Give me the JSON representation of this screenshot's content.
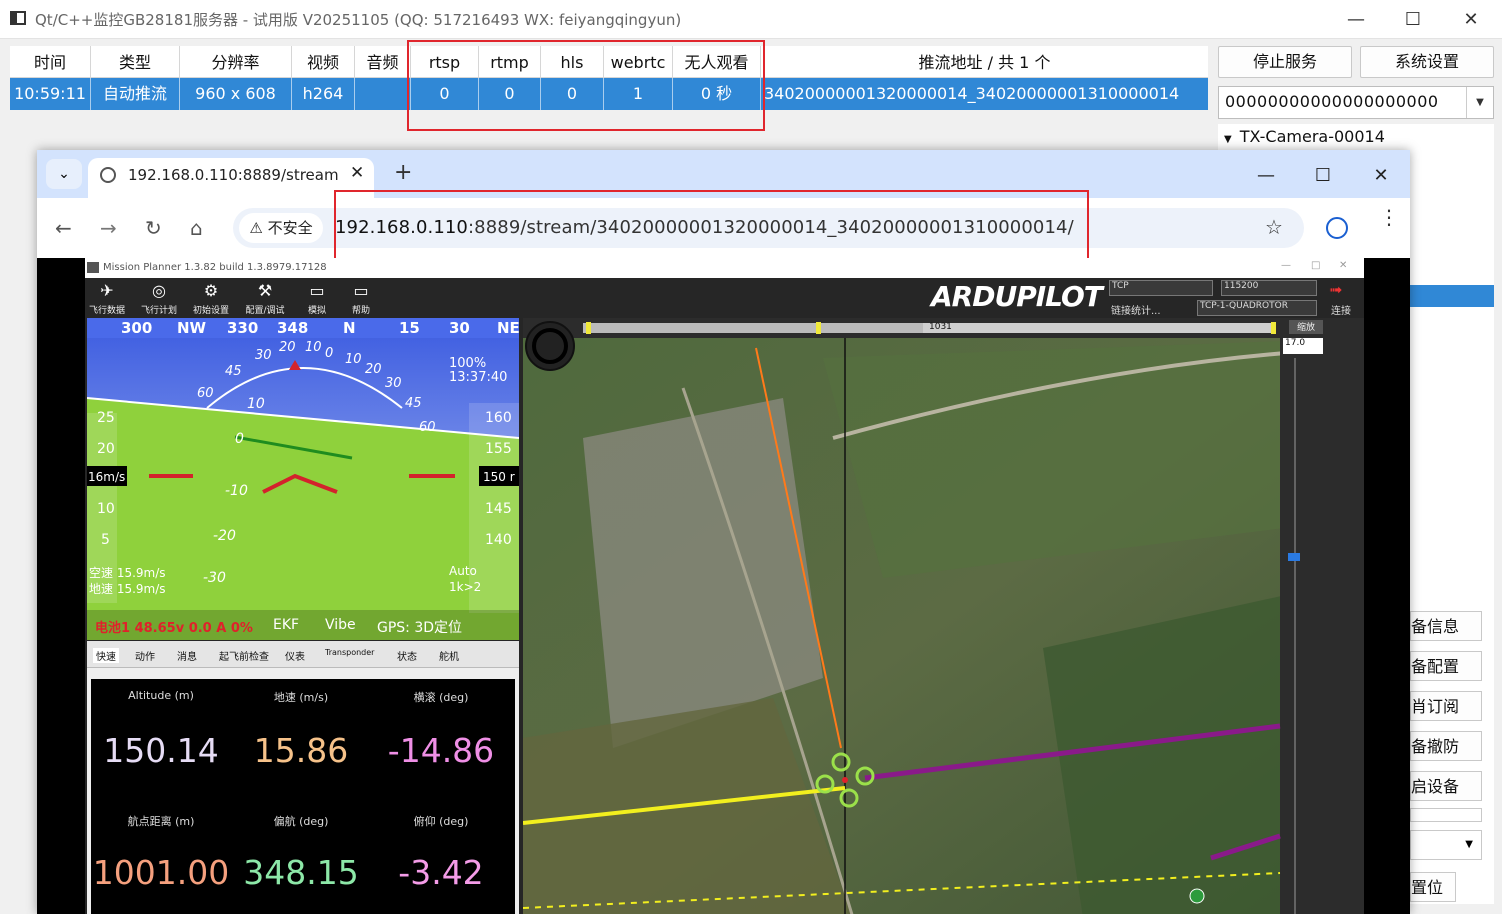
{
  "window": {
    "title": "Qt/C++监控GB28181服务器 - 试用版 V20251105 (QQ: 517216493 WX: feiyangqingyun)",
    "min_icon": "minimize-icon",
    "max_icon": "maximize-icon",
    "close_icon": "close-icon"
  },
  "stream_table": {
    "headers": [
      "时间",
      "类型",
      "分辨率",
      "视频",
      "音频",
      "rtsp",
      "rtmp",
      "hls",
      "webrtc",
      "无人观看",
      "推流地址 / 共 1 个"
    ],
    "row": [
      "10:59:11",
      "自动推流",
      "960 x 608",
      "h264",
      "",
      "0",
      "0",
      "0",
      "1",
      "0 秒",
      "34020000001320000014_34020000001310000014"
    ]
  },
  "side_panel": {
    "stop_service": "停止服务",
    "system_settings": "系统设置",
    "device_combo_value": "00000000000000000000",
    "tree_item": "TX-Camera-00014",
    "buttons": [
      "备信息",
      "备配置",
      "肖订阅",
      "备撤防",
      "启设备"
    ],
    "reset_button": "置位"
  },
  "browser": {
    "tab_title": "192.168.0.110:8889/stream/3",
    "security_label": "不安全",
    "url_host": "192.168.0.110",
    "url_rest": ":8889/stream/34020000001320000014_34020000001310000014/",
    "new_tab": "+"
  },
  "mission_planner": {
    "title": "Mission Planner 1.3.82 build 1.3.8979.17128",
    "menu": [
      "飞行数据",
      "飞行计划",
      "初始设置",
      "配置/调试",
      "模拟",
      "帮助"
    ],
    "logo": "ARDUPILOT",
    "port": "TCP",
    "baud": "115200",
    "link_stats": "链接统计...",
    "frame": "TCP-1-QUADROTOR",
    "connect": "连接",
    "hud": {
      "heading_scale": [
        "300",
        "NW",
        "330",
        "348",
        "N",
        "15",
        "30",
        "NE"
      ],
      "battery_pct": "100%",
      "time": "13:37:40",
      "speed_box": "16m/s",
      "alt_box": "150 r",
      "speed_ticks": [
        "25",
        "20",
        "10",
        "5"
      ],
      "alt_ticks": [
        "160",
        "155",
        "145",
        "140"
      ],
      "pitch_ticks": [
        "10",
        "0",
        "-10",
        "-20",
        "-30"
      ],
      "roll_ticks": [
        "60",
        "45",
        "30",
        "20",
        "10",
        "0",
        "10",
        "20",
        "30",
        "45",
        "60"
      ],
      "airspeed": "空速 15.9m/s",
      "groundspeed": "地速 15.9m/s",
      "mode": "Auto",
      "wp": "1k>2",
      "battery_line": "电池1 48.65v 0.0 A 0%",
      "ekf": "EKF",
      "vibe": "Vibe",
      "gps": "GPS: 3D定位"
    },
    "data_tabs": [
      "快速",
      "动作",
      "消息",
      "起飞前检查",
      "仪表",
      "Transponder",
      "状态",
      "舵机"
    ],
    "quick": [
      {
        "label": "Altitude (m)",
        "value": "150.14",
        "color": "#e6dcf5"
      },
      {
        "label": "地速 (m/s)",
        "value": "15.86",
        "color": "#f6c28a"
      },
      {
        "label": "横滚 (deg)",
        "value": "-14.86",
        "color": "#ef8fe6"
      },
      {
        "label": "航点距离 (m)",
        "value": "1001.00",
        "color": "#f5a07e"
      },
      {
        "label": "偏航 (deg)",
        "value": "348.15",
        "color": "#8de8a8"
      },
      {
        "label": "俯仰 (deg)",
        "value": "-3.42",
        "color": "#f49ce8"
      }
    ],
    "map": {
      "scale_value": "1031",
      "zoom_label": "缩放",
      "zoom_value": "17.0"
    }
  },
  "colors": {
    "selection": "#3088d6",
    "highlight_box": "#e0262d",
    "flight_path": "#8a1a8a",
    "track_line": "#f2ef1e",
    "heading_line": "#ff7a1a"
  }
}
